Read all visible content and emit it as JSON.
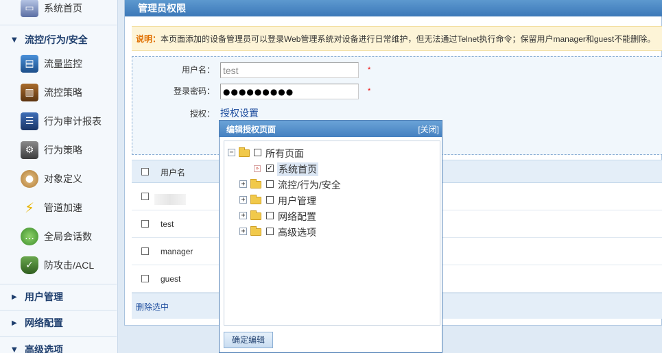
{
  "sidebar": {
    "items": [
      {
        "label": "系统首页",
        "icon": "monitor-icon"
      },
      {
        "label": "流量监控",
        "icon": "traffic-monitor-icon"
      },
      {
        "label": "流控策略",
        "icon": "flow-policy-icon"
      },
      {
        "label": "行为审计报表",
        "icon": "audit-report-icon"
      },
      {
        "label": "行为策略",
        "icon": "behavior-policy-icon"
      },
      {
        "label": "对象定义",
        "icon": "palette-icon"
      },
      {
        "label": "管道加速",
        "icon": "acceleration-icon"
      },
      {
        "label": "全局会话数",
        "icon": "chat-icon"
      },
      {
        "label": "防攻击/ACL",
        "icon": "shield-icon"
      }
    ],
    "sections": [
      {
        "label": "流控/行为/安全",
        "expanded": true
      },
      {
        "label": "用户管理",
        "expanded": false
      },
      {
        "label": "网络配置",
        "expanded": false
      },
      {
        "label": "高级选项",
        "expanded": true
      }
    ]
  },
  "main": {
    "title": "管理员权限",
    "note_label": "说明：",
    "note_text": "本页面添加的设备管理员可以登录Web管理系统对设备进行日常维护，但无法通过Telnet执行命令；保留用户manager和guest不能删除。",
    "form": {
      "username_label": "用户名：",
      "username_value": "test",
      "password_label": "登录密码：",
      "password_value": "●●●●●●●●●",
      "auth_label": "授权：",
      "auth_link": "授权设置",
      "required_mark": "*"
    },
    "table": {
      "header": "用户名",
      "rows": [
        "",
        "test",
        "manager",
        "guest"
      ],
      "delete_label": "删除选中"
    }
  },
  "popup": {
    "title": "编辑授权页面",
    "close_label": "[关闭]",
    "tree": {
      "root": "所有页面",
      "children": [
        "系统首页",
        "流控/行为/安全",
        "用户管理",
        "网络配置",
        "高级选项"
      ]
    },
    "checked": [
      "系统首页"
    ],
    "confirm_label": "确定编辑"
  }
}
